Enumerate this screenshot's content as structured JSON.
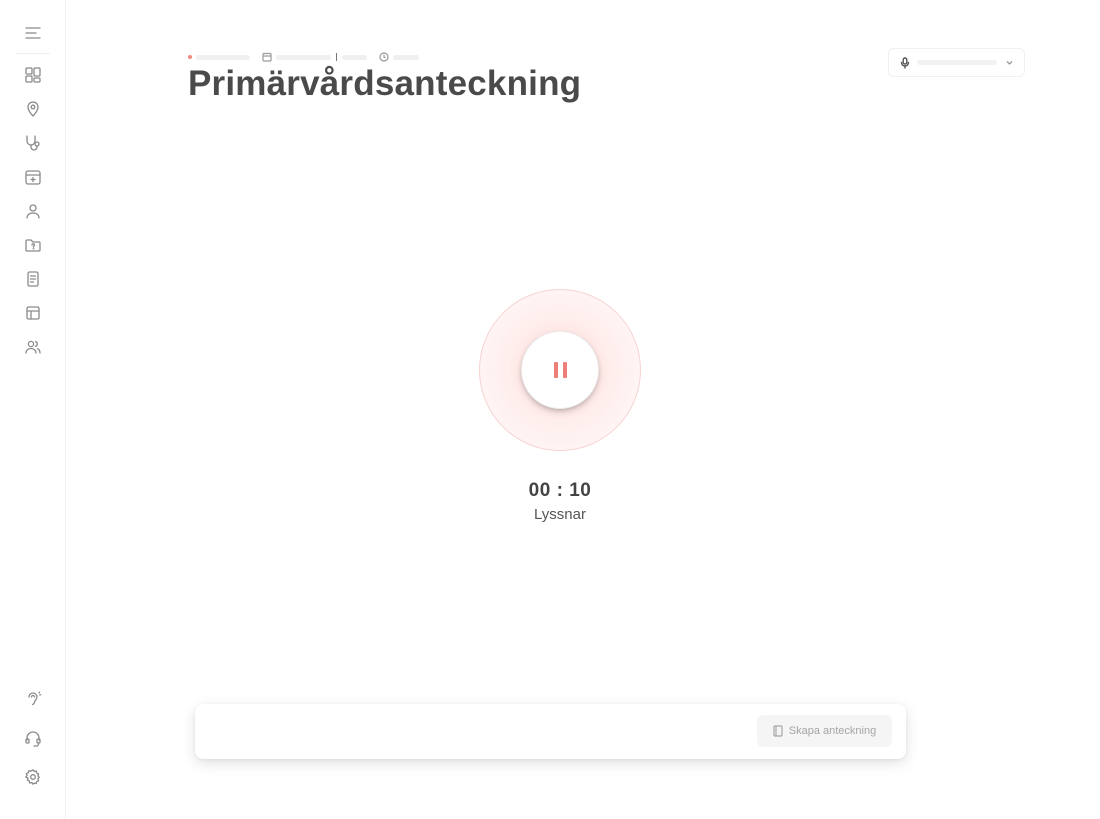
{
  "page": {
    "title": "Primärvårdsanteckning"
  },
  "sidebar": {
    "top_items": [
      {
        "name": "menu",
        "icon": "menu-icon"
      },
      {
        "name": "dashboard",
        "icon": "dashboard-icon"
      },
      {
        "name": "location",
        "icon": "map-pin-icon"
      },
      {
        "name": "consultation",
        "icon": "stethoscope-icon"
      },
      {
        "name": "calendar",
        "icon": "calendar-plus-icon"
      },
      {
        "name": "patient",
        "icon": "user-icon"
      },
      {
        "name": "folder",
        "icon": "folder-question-icon"
      },
      {
        "name": "notes",
        "icon": "document-icon"
      },
      {
        "name": "templates",
        "icon": "layout-icon"
      },
      {
        "name": "team",
        "icon": "users-icon"
      }
    ],
    "bottom_items": [
      {
        "name": "dictation",
        "icon": "ear-icon"
      },
      {
        "name": "support",
        "icon": "headset-icon"
      },
      {
        "name": "settings",
        "icon": "gear-icon"
      }
    ]
  },
  "recorder": {
    "timer": "00 : 10",
    "status": "Lyssnar",
    "state": "recording",
    "accent": "#ec8078"
  },
  "actions": {
    "create_note_label": "Skapa anteckning"
  },
  "colors": {
    "accent": "#ec8078",
    "text": "#4a4a4a"
  }
}
